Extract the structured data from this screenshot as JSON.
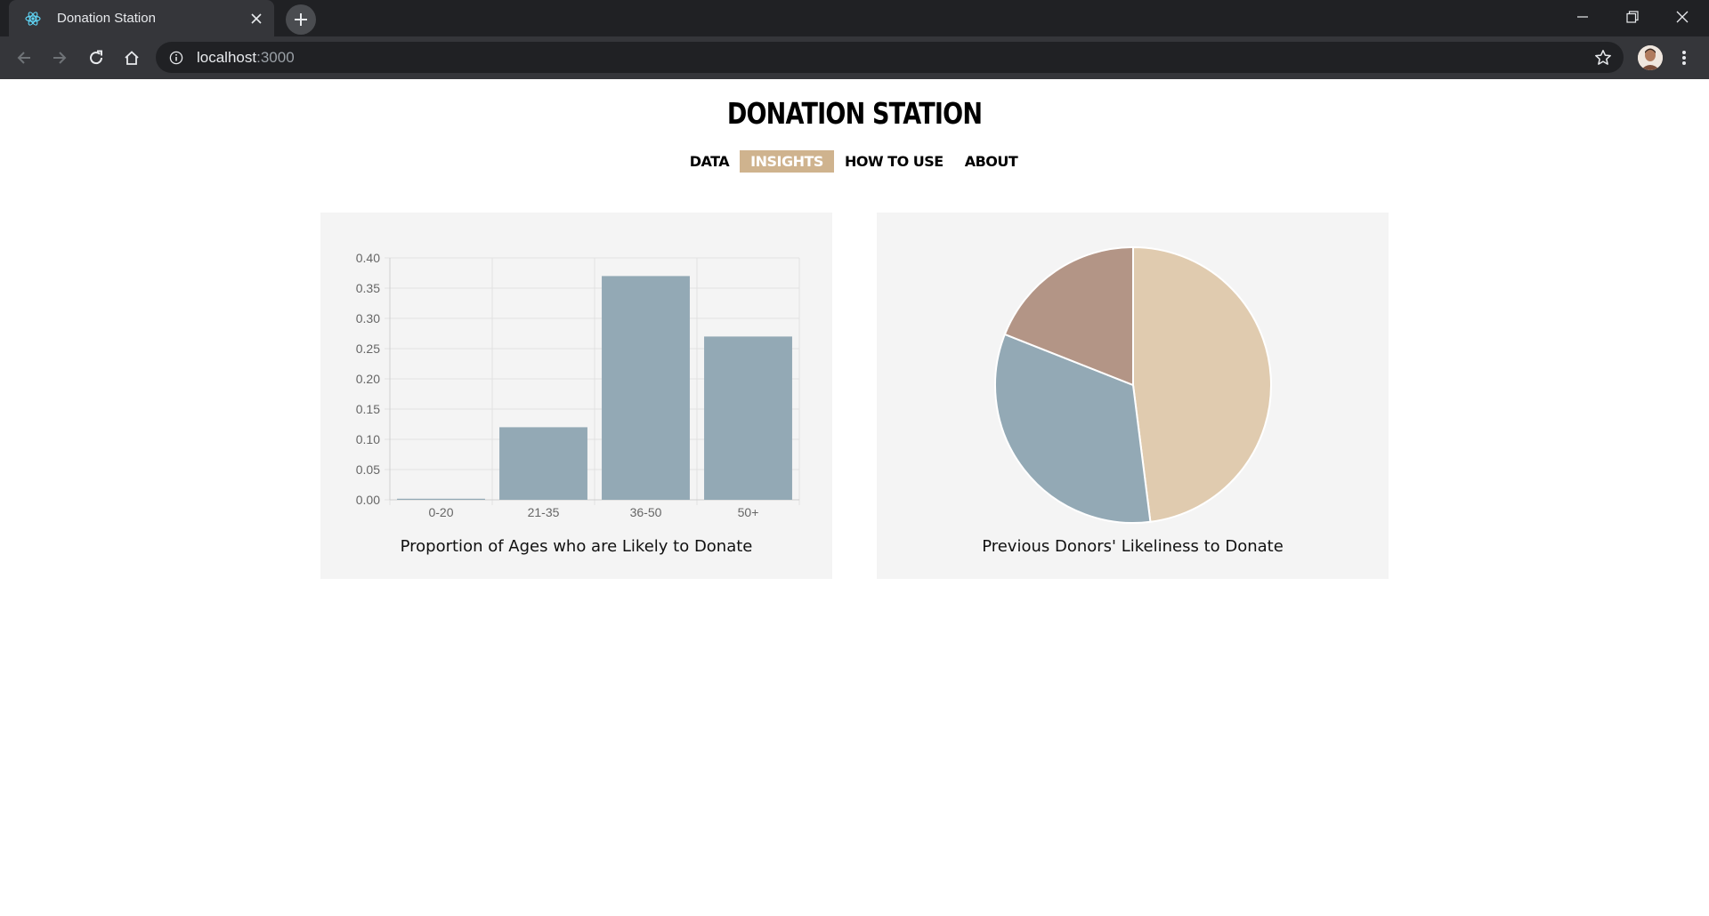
{
  "browser": {
    "tab_title": "Donation Station",
    "url_host": "localhost",
    "url_port": ":3000"
  },
  "site": {
    "title": "DONATION STATION",
    "nav": [
      {
        "label": "DATA",
        "active": false
      },
      {
        "label": "INSIGHTS",
        "active": true
      },
      {
        "label": "HOW TO USE",
        "active": false
      },
      {
        "label": "ABOUT",
        "active": false
      }
    ],
    "accent_color": "#cfb38e"
  },
  "chart_data": [
    {
      "type": "bar",
      "title": "Proportion of Ages who are Likely to Donate",
      "categories": [
        "0-20",
        "21-35",
        "36-50",
        "50+"
      ],
      "values": [
        0.0,
        0.12,
        0.37,
        0.27
      ],
      "ylim": [
        0,
        0.4
      ],
      "yticks": [
        "0.40",
        "0.35",
        "0.30",
        "0.25",
        "0.20",
        "0.15",
        "0.10",
        "0.05",
        "0.00"
      ],
      "bar_color": "#93a9b5",
      "grid": true
    },
    {
      "type": "pie",
      "title": "Previous Donors' Likeliness to Donate",
      "values": [
        0.48,
        0.33,
        0.19
      ],
      "colors": [
        "#e0cbaf",
        "#93a9b5",
        "#b39586"
      ]
    }
  ]
}
